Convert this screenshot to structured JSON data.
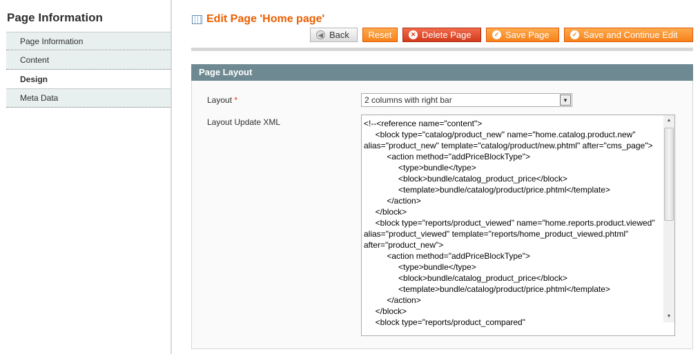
{
  "sidebar": {
    "title": "Page Information",
    "tabs": [
      {
        "label": "Page Information"
      },
      {
        "label": "Content"
      },
      {
        "label": "Design",
        "active": true
      },
      {
        "label": "Meta Data"
      }
    ]
  },
  "header": {
    "title": "Edit Page 'Home page'",
    "icon": "grid-icon"
  },
  "buttons": {
    "back": "Back",
    "reset": "Reset",
    "delete": "Delete Page",
    "save": "Save Page",
    "save_continue": "Save and Continue Edit"
  },
  "colors": {
    "accent": "#eb5e00",
    "section_header": "#6f8992",
    "button": "#f7821b",
    "delete_button": "#d43a1a"
  },
  "section": {
    "title": "Page Layout"
  },
  "form": {
    "layout_label": "Layout",
    "required_mark": "*",
    "layout_value": "2 columns with right bar",
    "xml_label": "Layout Update XML",
    "xml_value": "<!--<reference name=\"content\">\n\t<block type=\"catalog/product_new\" name=\"home.catalog.product.new\" alias=\"product_new\" template=\"catalog/product/new.phtml\" after=\"cms_page\">\n\t\t<action method=\"addPriceBlockType\">\n\t\t\t<type>bundle</type>\n\t\t\t<block>bundle/catalog_product_price</block>\n\t\t\t<template>bundle/catalog/product/price.phtml</template>\n\t\t</action>\n\t</block>\n\t<block type=\"reports/product_viewed\" name=\"home.reports.product.viewed\" alias=\"product_viewed\" template=\"reports/home_product_viewed.phtml\" after=\"product_new\">\n\t\t<action method=\"addPriceBlockType\">\n\t\t\t<type>bundle</type>\n\t\t\t<block>bundle/catalog_product_price</block>\n\t\t\t<template>bundle/catalog/product/price.phtml</template>\n\t\t</action>\n\t</block>\n\t<block type=\"reports/product_compared\""
  }
}
